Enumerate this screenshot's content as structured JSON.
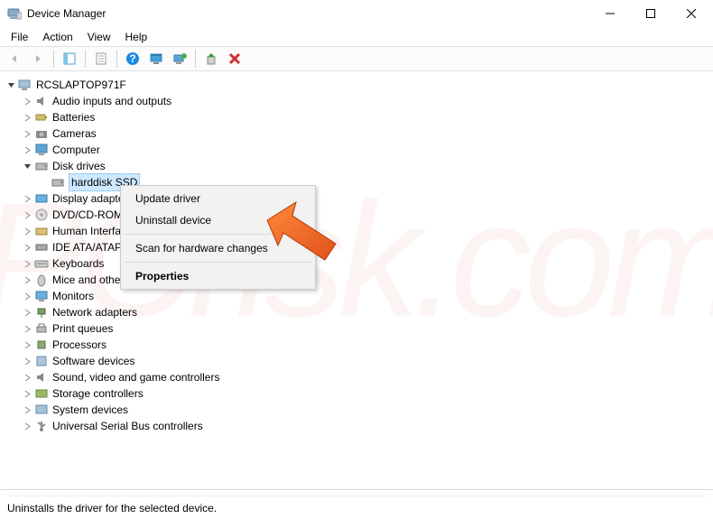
{
  "window": {
    "title": "Device Manager"
  },
  "menu": {
    "file": "File",
    "action": "Action",
    "view": "View",
    "help": "Help"
  },
  "tree": {
    "root": "RCSLAPTOP971F",
    "nodes": {
      "audio": "Audio inputs and outputs",
      "batteries": "Batteries",
      "cameras": "Cameras",
      "computer": "Computer",
      "diskdrives": "Disk drives",
      "harddisk": "harddisk SSD",
      "display": "Display adapters",
      "dvdcd": "DVD/CD-ROM drives",
      "hid": "Human Interface Devices",
      "ide": "IDE ATA/ATAPI controllers",
      "keyboards": "Keyboards",
      "mice": "Mice and other pointing devices",
      "monitors": "Monitors",
      "network": "Network adapters",
      "printq": "Print queues",
      "processors": "Processors",
      "software": "Software devices",
      "sound": "Sound, video and game controllers",
      "storage": "Storage controllers",
      "system": "System devices",
      "usb": "Universal Serial Bus controllers"
    }
  },
  "context_menu": {
    "update": "Update driver",
    "uninstall": "Uninstall device",
    "scan": "Scan for hardware changes",
    "properties": "Properties"
  },
  "statusbar": {
    "text": "Uninstalls the driver for the selected device."
  }
}
